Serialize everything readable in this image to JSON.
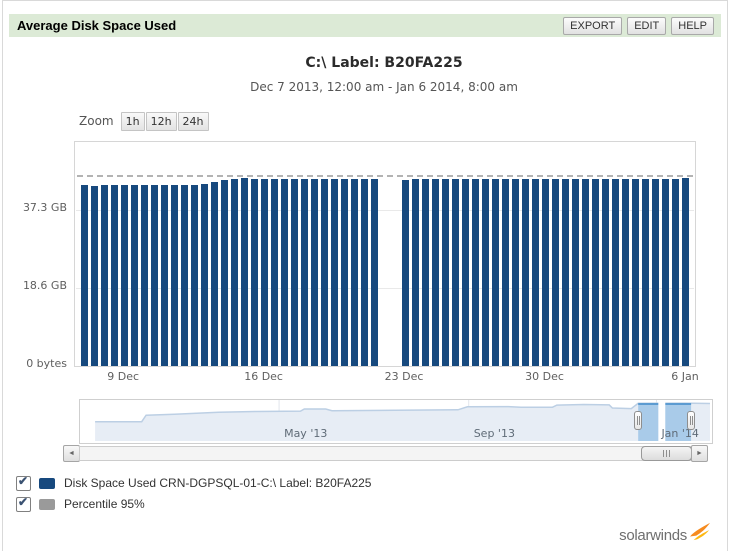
{
  "widget": {
    "title": "Average Disk Space Used"
  },
  "header_buttons": {
    "export": "EXPORT",
    "edit": "EDIT",
    "help": "HELP"
  },
  "toolbar": {
    "zoom_label": "Zoom",
    "zoom_1h": "1h",
    "zoom_12h": "12h",
    "zoom_24h": "24h"
  },
  "chart_data": {
    "type": "bar",
    "title": "C:\\ Label: B20FA225",
    "subtitle": "Dec 7 2013, 12:00 am - Jan 6 2014, 8:00 am",
    "unit": "GB",
    "bar_interval_hours": 12,
    "ylim": [
      0,
      53.5
    ],
    "grid": true,
    "y_ticks": [
      {
        "value": 0,
        "label": "0 bytes"
      },
      {
        "value": 18.63,
        "label": "18.6 GB"
      },
      {
        "value": 37.25,
        "label": "37.3 GB"
      }
    ],
    "x_ticks": [
      {
        "slot": 4,
        "label": "9 Dec"
      },
      {
        "slot": 18,
        "label": "16 Dec"
      },
      {
        "slot": 32,
        "label": "23 Dec"
      },
      {
        "slot": 46,
        "label": "30 Dec"
      },
      {
        "slot": 60,
        "label": "6 Jan"
      }
    ],
    "series": [
      {
        "name": "Disk Space Used CRN-DGPSQL-01-C:\\ Label: B20FA225",
        "color": "#17497E",
        "values": [
          43.2,
          43.1,
          43.2,
          43.2,
          43.3,
          43.2,
          43.2,
          43.3,
          43.2,
          43.2,
          43.3,
          43.2,
          43.4,
          43.9,
          44.5,
          44.7,
          44.8,
          44.7,
          44.6,
          44.7,
          44.7,
          44.6,
          44.7,
          44.6,
          44.7,
          44.7,
          44.6,
          44.7,
          44.7,
          44.6,
          null,
          null,
          44.5,
          44.6,
          44.7,
          44.6,
          44.7,
          44.7,
          44.6,
          44.7,
          44.6,
          44.7,
          44.7,
          44.6,
          44.7,
          44.7,
          44.6,
          44.7,
          44.6,
          44.7,
          44.7,
          44.6,
          44.7,
          44.7,
          44.6,
          44.7,
          44.6,
          44.7,
          44.7,
          44.6,
          44.8
        ]
      },
      {
        "name": "Percentile 95%",
        "color": "#9A9A9A",
        "style": "dashed-line",
        "value": 45.2
      }
    ],
    "navigator": {
      "x_ticks": [
        {
          "frac": 0.316,
          "label": "May '13"
        },
        {
          "frac": 0.617,
          "label": "Sep '13"
        },
        {
          "frac": 0.915,
          "label": "Jan '14"
        }
      ],
      "selection": {
        "from_frac": 0.886,
        "to_frac": 0.97
      },
      "gap_frac": [
        0.918,
        0.929
      ],
      "profile": [
        [
          0.024,
          0.53
        ],
        [
          0.098,
          0.53
        ],
        [
          0.105,
          0.37
        ],
        [
          0.15,
          0.35
        ],
        [
          0.22,
          0.3
        ],
        [
          0.28,
          0.28
        ],
        [
          0.35,
          0.27
        ],
        [
          0.356,
          0.22
        ],
        [
          0.39,
          0.22
        ],
        [
          0.4,
          0.26
        ],
        [
          0.5,
          0.25
        ],
        [
          0.6,
          0.24
        ],
        [
          0.615,
          0.165
        ],
        [
          0.68,
          0.16
        ],
        [
          0.7,
          0.175
        ],
        [
          0.75,
          0.175
        ],
        [
          0.757,
          0.125
        ],
        [
          0.8,
          0.11
        ],
        [
          0.84,
          0.12
        ],
        [
          0.845,
          0.195
        ],
        [
          0.875,
          0.21
        ],
        [
          0.886,
          0.08
        ],
        [
          0.96,
          0.075
        ],
        [
          1.0,
          0.085
        ]
      ]
    }
  },
  "legend": {
    "items": [
      {
        "checked": true,
        "color": "#17497E",
        "label": "Disk Space Used CRN-DGPSQL-01-C:\\ Label: B20FA225"
      },
      {
        "checked": true,
        "color": "#9A9A9A",
        "label": "Percentile 95%"
      }
    ]
  },
  "footer": {
    "brand": "solarwinds"
  },
  "icons": {
    "scroll_left": "◄",
    "scroll_right": "►",
    "checkmark": "✔"
  },
  "colors": {
    "header_bg": "#dcead6",
    "bar": "#17497E",
    "percentile_line": "#b3b3b3",
    "nav_area_fill": "#e7edf5",
    "nav_area_line": "#bccfe4",
    "nav_selection_fill": "#a9cbe9",
    "nav_selection_line": "#5c9bd1",
    "brand_orange": "#F9A21A"
  }
}
